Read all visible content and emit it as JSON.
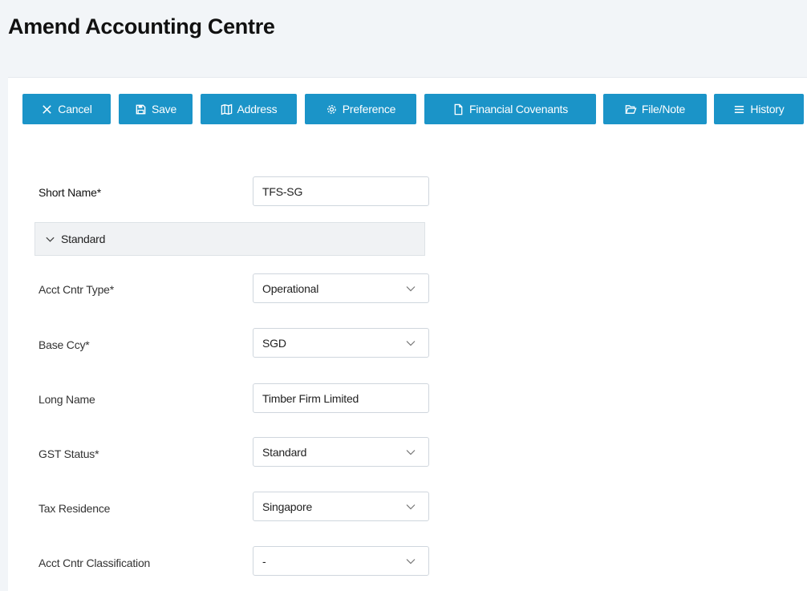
{
  "page": {
    "title": "Amend Accounting Centre"
  },
  "toolbar": {
    "cancel": {
      "label": "Cancel",
      "icon": "close-icon"
    },
    "save": {
      "label": "Save",
      "icon": "floppy-disk-icon"
    },
    "address": {
      "label": "Address",
      "icon": "map-icon"
    },
    "preference": {
      "label": "Preference",
      "icon": "gear-icon"
    },
    "financial_covenants": {
      "label": "Financial Covenants",
      "icon": "document-icon"
    },
    "file_note": {
      "label": "File/Note",
      "icon": "folder-open-icon"
    },
    "history": {
      "label": "History",
      "icon": "list-icon"
    },
    "button_color": "#1b94c8"
  },
  "form": {
    "short_name": {
      "label": "Short Name*",
      "value": "TFS-SG"
    },
    "section": {
      "label": "Standard",
      "icon": "chevron-down-icon",
      "expanded": true
    },
    "acct_cntr_type": {
      "label": "Acct Cntr Type*",
      "value": "Operational"
    },
    "base_ccy": {
      "label": "Base Ccy*",
      "value": "SGD"
    },
    "long_name": {
      "label": "Long Name",
      "value": "Timber Firm Limited"
    },
    "gst_status": {
      "label": "GST Status*",
      "value": "Standard"
    },
    "tax_residence": {
      "label": "Tax Residence",
      "value": "Singapore"
    },
    "acct_cntr_classification": {
      "label": "Acct Cntr Classification",
      "value": "-"
    }
  }
}
